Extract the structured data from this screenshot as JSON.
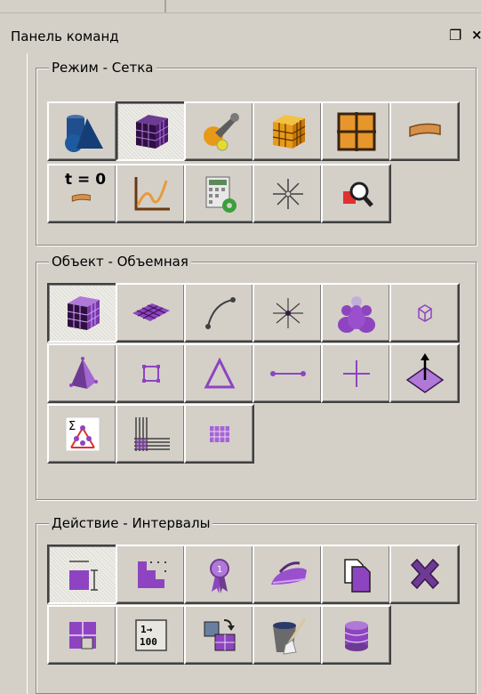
{
  "panel": {
    "title": "Панель команд"
  },
  "colors": {
    "face": "#d4d0c8",
    "purple": "#8e44c0",
    "dark_purple": "#4a1a6a",
    "orange": "#e79a18"
  },
  "groups": [
    {
      "label": "Режим - Сетка",
      "buttons": [
        {
          "name": "geometry-mode-button",
          "icon": "geometry-shapes-icon",
          "pressed": false
        },
        {
          "name": "mesh-mode-button",
          "icon": "mesh-cube-icon",
          "pressed": true
        },
        {
          "name": "boundary-zones-button",
          "icon": "wrench-shapes-icon",
          "pressed": false
        },
        {
          "name": "solver-mode-button",
          "icon": "orange-cube-icon",
          "pressed": false
        },
        {
          "name": "grid-mode-button",
          "icon": "grid-window-icon",
          "pressed": false
        },
        {
          "name": "surface-button",
          "icon": "surface-strip-icon",
          "pressed": false
        },
        {
          "name": "time-zero-button",
          "icon": "time-zero-icon",
          "pressed": false,
          "text": "t = 0"
        },
        {
          "name": "plot-button",
          "icon": "line-chart-icon",
          "pressed": false
        },
        {
          "name": "calculator-button",
          "icon": "calculator-gear-icon",
          "pressed": false
        },
        {
          "name": "point-button",
          "icon": "star-point-icon",
          "pressed": false
        },
        {
          "name": "inspect-button",
          "icon": "magnifier-icon",
          "pressed": false
        }
      ]
    },
    {
      "label": "Объект - Объемная",
      "buttons": [
        {
          "name": "volume-object-button",
          "icon": "purple-cube-icon",
          "pressed": true
        },
        {
          "name": "face-object-button",
          "icon": "purple-surface-icon",
          "pressed": false
        },
        {
          "name": "edge-object-button",
          "icon": "curve-edge-icon",
          "pressed": false
        },
        {
          "name": "vertex-object-button",
          "icon": "vertex-star-icon",
          "pressed": false
        },
        {
          "name": "group-object-button",
          "icon": "people-group-icon",
          "pressed": false
        },
        {
          "name": "node-object-button",
          "icon": "small-cube-icon",
          "pressed": false
        },
        {
          "name": "tetra-button",
          "icon": "tetrahedron-icon",
          "pressed": false
        },
        {
          "name": "quad-face-button",
          "icon": "quad-icon",
          "pressed": false
        },
        {
          "name": "triangle-face-button",
          "icon": "triangle-icon",
          "pressed": false
        },
        {
          "name": "line-element-button",
          "icon": "line-segment-icon",
          "pressed": false
        },
        {
          "name": "point-element-button",
          "icon": "cross-point-icon",
          "pressed": false
        },
        {
          "name": "normal-vector-button",
          "icon": "normal-arrow-icon",
          "pressed": false
        },
        {
          "name": "summation-button",
          "icon": "sigma-network-icon",
          "pressed": false
        },
        {
          "name": "boundary-layer-button",
          "icon": "boundary-layers-icon",
          "pressed": false
        },
        {
          "name": "structured-grid-button",
          "icon": "purple-grid-icon",
          "pressed": false
        }
      ]
    },
    {
      "label": "Действие - Интервалы",
      "buttons": [
        {
          "name": "interval-size-button",
          "icon": "interval-block-icon",
          "pressed": true
        },
        {
          "name": "interval-steps-button",
          "icon": "step-blocks-icon",
          "pressed": false
        },
        {
          "name": "priority-button",
          "icon": "ribbon-badge-icon",
          "pressed": false
        },
        {
          "name": "smooth-button",
          "icon": "iron-icon",
          "pressed": false
        },
        {
          "name": "copy-button",
          "icon": "copy-pages-icon",
          "pressed": false
        },
        {
          "name": "delete-button",
          "icon": "delete-x-icon",
          "pressed": false
        },
        {
          "name": "split-button",
          "icon": "split-grid-icon",
          "pressed": false
        },
        {
          "name": "interval-count-button",
          "icon": "count-range-icon",
          "pressed": false,
          "text_top": "1→",
          "text_bottom": "100"
        },
        {
          "name": "swap-button",
          "icon": "swap-squares-icon",
          "pressed": false
        },
        {
          "name": "clean-button",
          "icon": "brush-bucket-icon",
          "pressed": false
        },
        {
          "name": "database-button",
          "icon": "database-icon",
          "pressed": false
        }
      ]
    }
  ]
}
